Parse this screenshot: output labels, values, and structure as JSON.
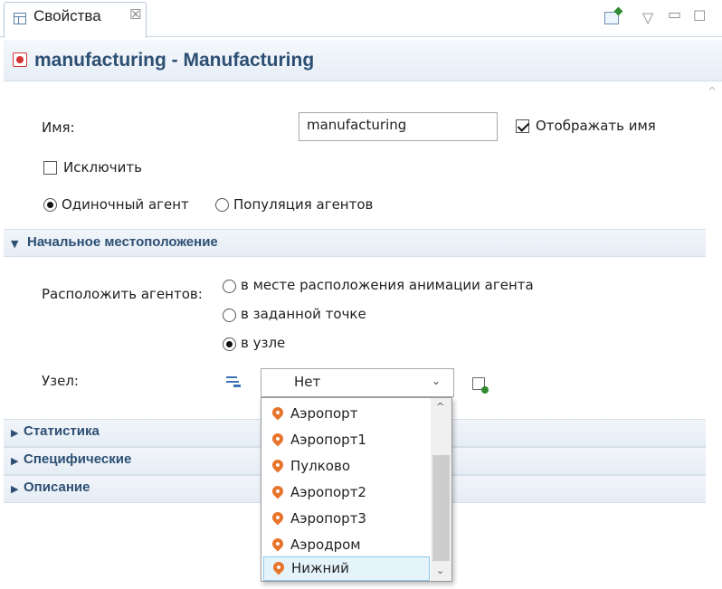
{
  "view_tab": {
    "label": "Свойства",
    "close": "☒"
  },
  "toolbar": {
    "menu_glyph": "▽",
    "minimize_glyph": "▭",
    "maximize_glyph": "☐"
  },
  "header": {
    "title": "manufacturing - Manufacturing"
  },
  "form": {
    "name_label": "Имя:",
    "name_value": "manufacturing",
    "show_name_label": "Отображать имя",
    "show_name_checked": true,
    "exclude_label": "Исключить",
    "exclude_checked": false,
    "single_agent_label": "Одиночный агент",
    "population_label": "Популяция агентов",
    "single_agent_selected": true
  },
  "initial_location": {
    "title": "Начальное местоположение",
    "place_label": "Расположить агентов:",
    "options": [
      {
        "label": "в месте расположения анимации агента",
        "selected": false
      },
      {
        "label": "в заданной точке",
        "selected": false
      },
      {
        "label": "в узле",
        "selected": true
      }
    ],
    "node_label": "Узел:",
    "node_value": "Нет",
    "node_options": [
      "Аэропорт",
      "Аэропорт1",
      "Пулково",
      "Аэропорт2",
      "Аэропорт3",
      "Аэродром",
      "Нижний"
    ],
    "highlighted_option": "Нижний"
  },
  "sections": [
    {
      "label": "Статистика"
    },
    {
      "label": "Специфические"
    },
    {
      "label": "Описание"
    }
  ],
  "glyphs": {
    "collapsed": "▶",
    "expanded": "▼",
    "combo_arrow": "⌄",
    "scroll_up": "^",
    "scroll_down": "⌄"
  }
}
